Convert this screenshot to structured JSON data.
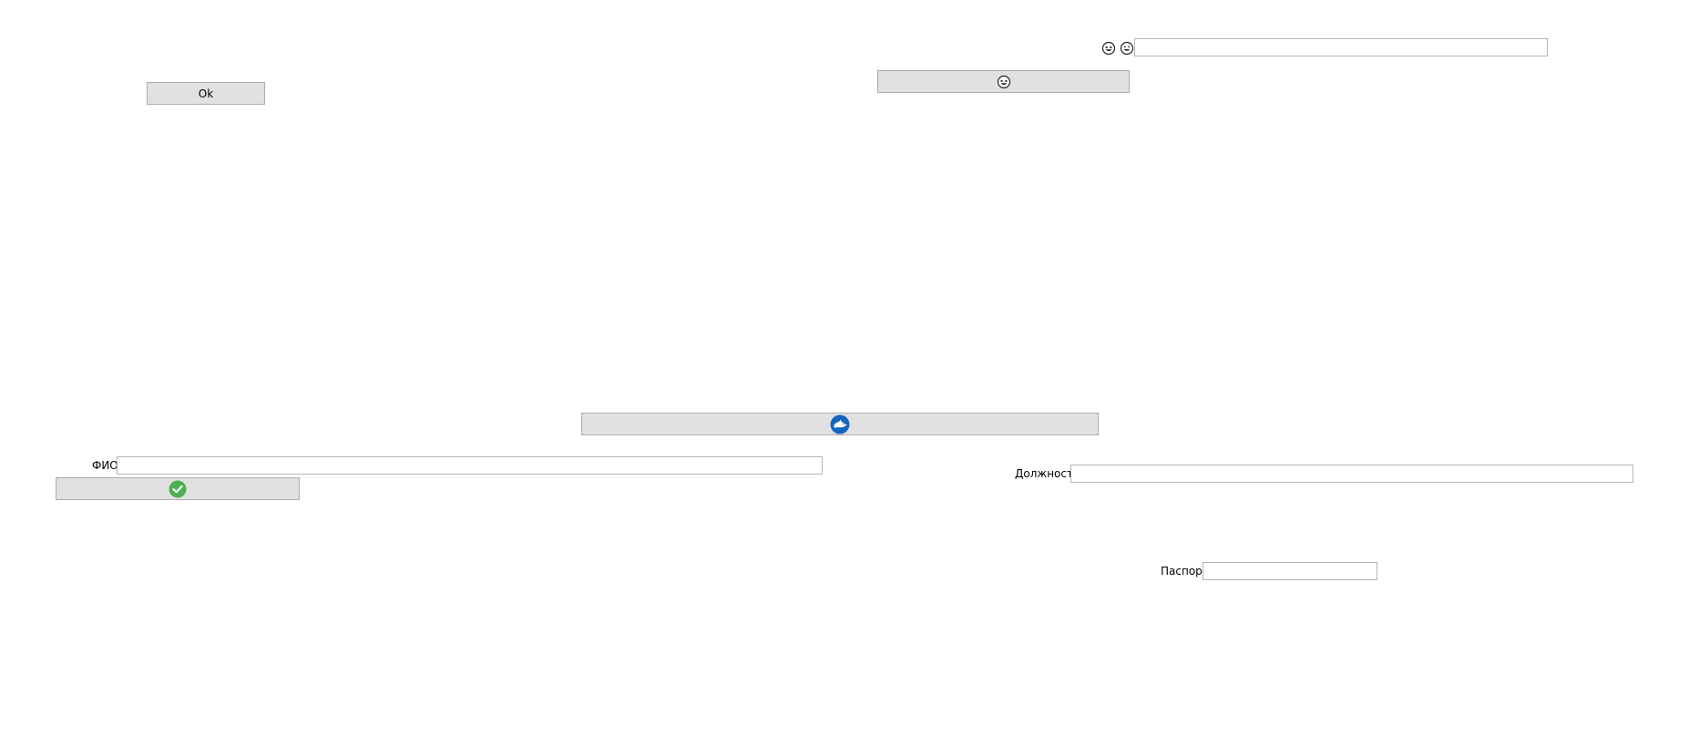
{
  "form": {
    "ok_button": {
      "label": "Ok"
    },
    "emoji_button": {
      "icon": "grinning-squint-face-icon"
    },
    "top_icons": [
      "grinning-squint-face-icon",
      "grinning-face-icon"
    ],
    "top_input": {
      "value": ""
    },
    "dolphin_button": {
      "icon": "dolphin-icon",
      "icon_color": "#1565c0"
    },
    "fio": {
      "label": "ФИО",
      "value": ""
    },
    "check_button": {
      "icon": "checkmark-icon",
      "icon_color": "#4caf50"
    },
    "position": {
      "label": "Должность",
      "value": ""
    },
    "passport": {
      "label": "Паспорт",
      "value": ""
    }
  },
  "colors": {
    "button_bg": "#e1e1e1",
    "button_border": "#adadad",
    "input_border": "#b4b4b4",
    "background": "#ffffff"
  }
}
